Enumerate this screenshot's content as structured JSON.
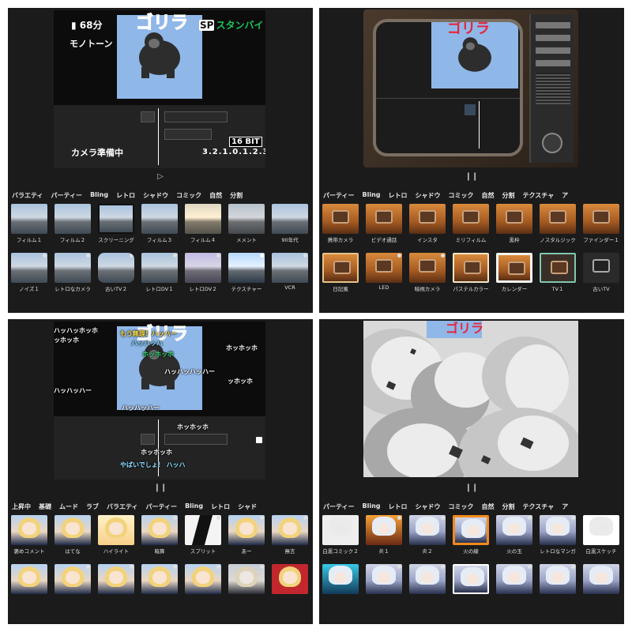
{
  "panel1": {
    "corner": "100",
    "battery": "68分",
    "mode": "モノトーン",
    "standby_sp": "SP",
    "standby": "スタンバイ",
    "camera_status": "カメラ準備中",
    "countdown": "3.2.1.0.1.2.3",
    "bits": "16 BIT",
    "title": "ゴリラ",
    "tabs": [
      "バラエティ",
      "パーティー",
      "Bling",
      "レトロ",
      "シャドウ",
      "コミック",
      "自然",
      "分割"
    ],
    "row1": [
      "フィルム１",
      "フィルム２",
      "スクリーニング",
      "フィルム３",
      "フィルム４",
      "メメント",
      "90年代"
    ],
    "row2": [
      "ノイズ１",
      "レトロなカメラ",
      "古いTV２",
      "レトロDV１",
      "レトロDV２",
      "テクスチャー",
      "VCR"
    ]
  },
  "panel2": {
    "corner": "100",
    "title": "ゴリラ",
    "tabs": [
      "パーティー",
      "Bling",
      "レトロ",
      "シャドウ",
      "コミック",
      "自然",
      "分割",
      "テクスチャ",
      "ア"
    ],
    "row1": [
      "携帯カメラ",
      "ビデオ通話",
      "インスタ",
      "ミリフィルム",
      "黒枠",
      "ノスタルジック",
      "ファインダー１"
    ],
    "row2": [
      "日記風",
      "LED",
      "暗視カメラ",
      "パステルカラー",
      "カレンダー",
      "TV１",
      "古いTV"
    ]
  },
  "panel3": {
    "corner": "100",
    "title": "ゴリラ",
    "captions": {
      "c1": "ハッハッホッホ",
      "c2": "ッホッホ",
      "c3": "もう無理！ハッハー",
      "c4": "ハッハッハ",
      "c5": "ホッホッホ",
      "c6": "ホッホッホ",
      "c7": "ハッハッハッハー",
      "c8": "ッホッホ",
      "c9": "ハッハッハー",
      "c10": "ハッハッハー",
      "c11": "ホッホッホ",
      "c12": "ホッホッホ",
      "c13": "やばいでしょ！ ハッハ"
    },
    "tabs": [
      "上昇中",
      "基礎",
      "ムード",
      "ラブ",
      "バラエティ",
      "パーティー",
      "Bling",
      "レトロ",
      "シャド"
    ],
    "row1": [
      "褒めコメント",
      "はてな",
      "ハイライト",
      "暗算",
      "スプリット",
      "あー",
      "無言"
    ]
  },
  "panel4": {
    "corner": "100",
    "title": "ゴリラ",
    "tabs": [
      "パーティー",
      "Bling",
      "レトロ",
      "シャドウ",
      "コミック",
      "自然",
      "分割",
      "テクスチャ",
      "ア"
    ],
    "row1": [
      "白黒コミック２",
      "炎１",
      "炎２",
      "火の線",
      "火の玉",
      "レトロなマンガ",
      "白黒スケッチ"
    ]
  }
}
